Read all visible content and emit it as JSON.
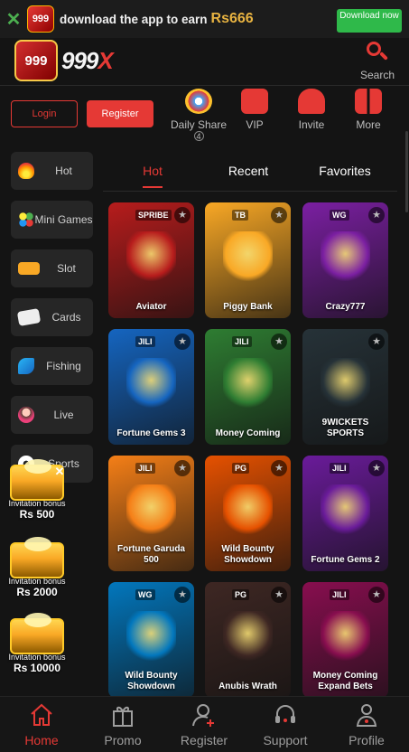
{
  "promo": {
    "close_icon": "close-icon",
    "logo_text": "999",
    "message": "download the app to earn",
    "amount": "Rs666",
    "download_label": "Download now"
  },
  "header": {
    "logo_text": "999",
    "brand_main": "999",
    "brand_x": "X",
    "search_label": "Search"
  },
  "auth": {
    "login_label": "Login",
    "register_label": "Register"
  },
  "quick_actions": [
    {
      "label": "Daily Share",
      "badge": "4",
      "icon": "daily-share-icon"
    },
    {
      "label": "VIP",
      "icon": "vip-icon"
    },
    {
      "label": "Invite",
      "icon": "invite-icon"
    },
    {
      "label": "More",
      "icon": "more-icon"
    }
  ],
  "sidebar": {
    "items": [
      {
        "label": "Hot",
        "icon": "flame-icon"
      },
      {
        "label": "Mini Games",
        "icon": "mini-games-icon"
      },
      {
        "label": "Slot",
        "icon": "slot-icon"
      },
      {
        "label": "Cards",
        "icon": "cards-icon"
      },
      {
        "label": "Fishing",
        "icon": "fish-icon"
      },
      {
        "label": "Live",
        "icon": "live-icon"
      },
      {
        "label": "Sports",
        "icon": "soccer-ball-icon"
      }
    ]
  },
  "tabs": [
    {
      "label": "Hot",
      "active": true
    },
    {
      "label": "Recent",
      "active": false
    },
    {
      "label": "Favorites",
      "active": false
    }
  ],
  "games": [
    {
      "name": "Aviator",
      "provider": "SPRIBE",
      "color": "#b71c1c"
    },
    {
      "name": "Piggy Bank",
      "provider": "TB",
      "color": "#f9a825"
    },
    {
      "name": "Crazy777",
      "provider": "WG",
      "color": "#7b1fa2"
    },
    {
      "name": "Fortune Gems 3",
      "provider": "JILI",
      "color": "#1565c0"
    },
    {
      "name": "Money Coming",
      "provider": "JILI",
      "color": "#2e7d32"
    },
    {
      "name": "9WICKETS SPORTS",
      "provider": "",
      "color": "#263238"
    },
    {
      "name": "Fortune Garuda 500",
      "provider": "JILI",
      "color": "#f57f17"
    },
    {
      "name": "Wild Bounty Showdown",
      "provider": "PG",
      "color": "#e65100"
    },
    {
      "name": "Fortune Gems 2",
      "provider": "JILI",
      "color": "#6a1b9a"
    },
    {
      "name": "Wild Bounty Showdown",
      "provider": "WG",
      "color": "#0277bd"
    },
    {
      "name": "Anubis Wrath",
      "provider": "PG",
      "color": "#3e2723"
    },
    {
      "name": "Money Coming Expand Bets",
      "provider": "JILI",
      "color": "#880e4f"
    }
  ],
  "invitation": {
    "close_icon": "close-icon",
    "items": [
      {
        "title": "Invitation bonus",
        "amount": "Rs 500"
      },
      {
        "title": "Invitation bonus",
        "amount": "Rs 2000"
      },
      {
        "title": "Invitation bonus",
        "amount": "Rs 10000"
      }
    ]
  },
  "bottom_nav": [
    {
      "label": "Home",
      "icon": "home-icon",
      "active": true
    },
    {
      "label": "Promo",
      "icon": "gift-icon",
      "active": false
    },
    {
      "label": "Register",
      "icon": "add-user-icon",
      "active": false
    },
    {
      "label": "Support",
      "icon": "headset-icon",
      "active": false
    },
    {
      "label": "Profile",
      "icon": "profile-icon",
      "active": false
    }
  ],
  "colors": {
    "accent": "#e53935",
    "download_green": "#2fb94a",
    "amount_gold": "#e8b341"
  }
}
